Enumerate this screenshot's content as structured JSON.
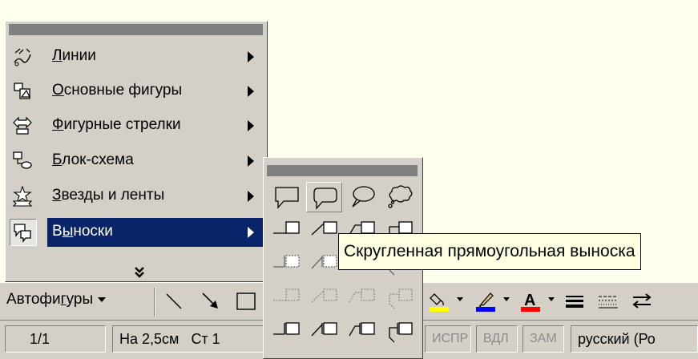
{
  "autoshapes_menu": {
    "items": [
      {
        "key": "lines",
        "underline_char": "Л",
        "label_rest": "инии",
        "label_full": "Линии",
        "icon": "lines-icon"
      },
      {
        "key": "basic-shapes",
        "underline_char": "О",
        "label_rest": "сновные фигуры",
        "label_full": "Основные фигуры",
        "icon": "basic-shapes-icon"
      },
      {
        "key": "block-arrows",
        "underline_char": "Ф",
        "label_rest": "игурные стрелки",
        "label_full": "Фигурные стрелки",
        "icon": "block-arrows-icon"
      },
      {
        "key": "flowchart",
        "underline_char": "Б",
        "label_rest": "лок-схема",
        "label_full": "Блок-схема",
        "icon": "flowchart-icon"
      },
      {
        "key": "stars-banners",
        "underline_char": "З",
        "label_rest": "везды и ленты",
        "label_full": "Звезды и ленты",
        "icon": "stars-banners-icon"
      },
      {
        "key": "callouts",
        "underline_pre": "В",
        "underline_char": "ы",
        "label_rest": "носки",
        "label_full": "Выноски",
        "icon": "callouts-icon",
        "selected": true
      }
    ],
    "more_glyph": "»"
  },
  "callouts_menu": {
    "hovered_item": "rounded-rectangular-callout",
    "rows": [
      [
        "rectangular-callout",
        "rounded-rectangular-callout",
        "oval-callout",
        "cloud-callout"
      ],
      [
        "line-callout-1",
        "line-callout-2",
        "line-callout-3",
        "line-callout-4"
      ],
      [
        "line-callout-1-accent-bar",
        "line-callout-2-accent-bar",
        "line-callout-3-accent-bar",
        "line-callout-4-accent-bar"
      ],
      [
        "line-callout-1-no-border",
        "line-callout-2-no-border",
        "line-callout-3-no-border",
        "line-callout-4-no-border"
      ],
      [
        "line-callout-1-border-accent",
        "line-callout-2-border-accent",
        "line-callout-3-border-accent",
        "line-callout-4-border-accent"
      ]
    ]
  },
  "tooltip": {
    "text": "Скругленная прямоугольная выноска"
  },
  "drawing_toolbar": {
    "autoshapes_pre": "Автофи",
    "autoshapes_underline": "г",
    "autoshapes_post": "уры",
    "tools": [
      "line-tool-icon",
      "arrow-tool-icon",
      "rectangle-tool-icon"
    ],
    "right_tools": [
      "fill-color-icon",
      "line-color-icon",
      "font-color-icon",
      "line-style-icon",
      "dash-style-icon",
      "arrow-style-icon"
    ],
    "colors": {
      "fill": "#FFFF00",
      "line": "#0000FF",
      "font": "#FF0000"
    }
  },
  "status_bar": {
    "page": "1/1",
    "position": "На 2,5см",
    "line": "Ст 1",
    "rec": "ИСПР",
    "ext": "ВДЛ",
    "ovr": "ЗАМ",
    "language": "русский (Ро"
  }
}
